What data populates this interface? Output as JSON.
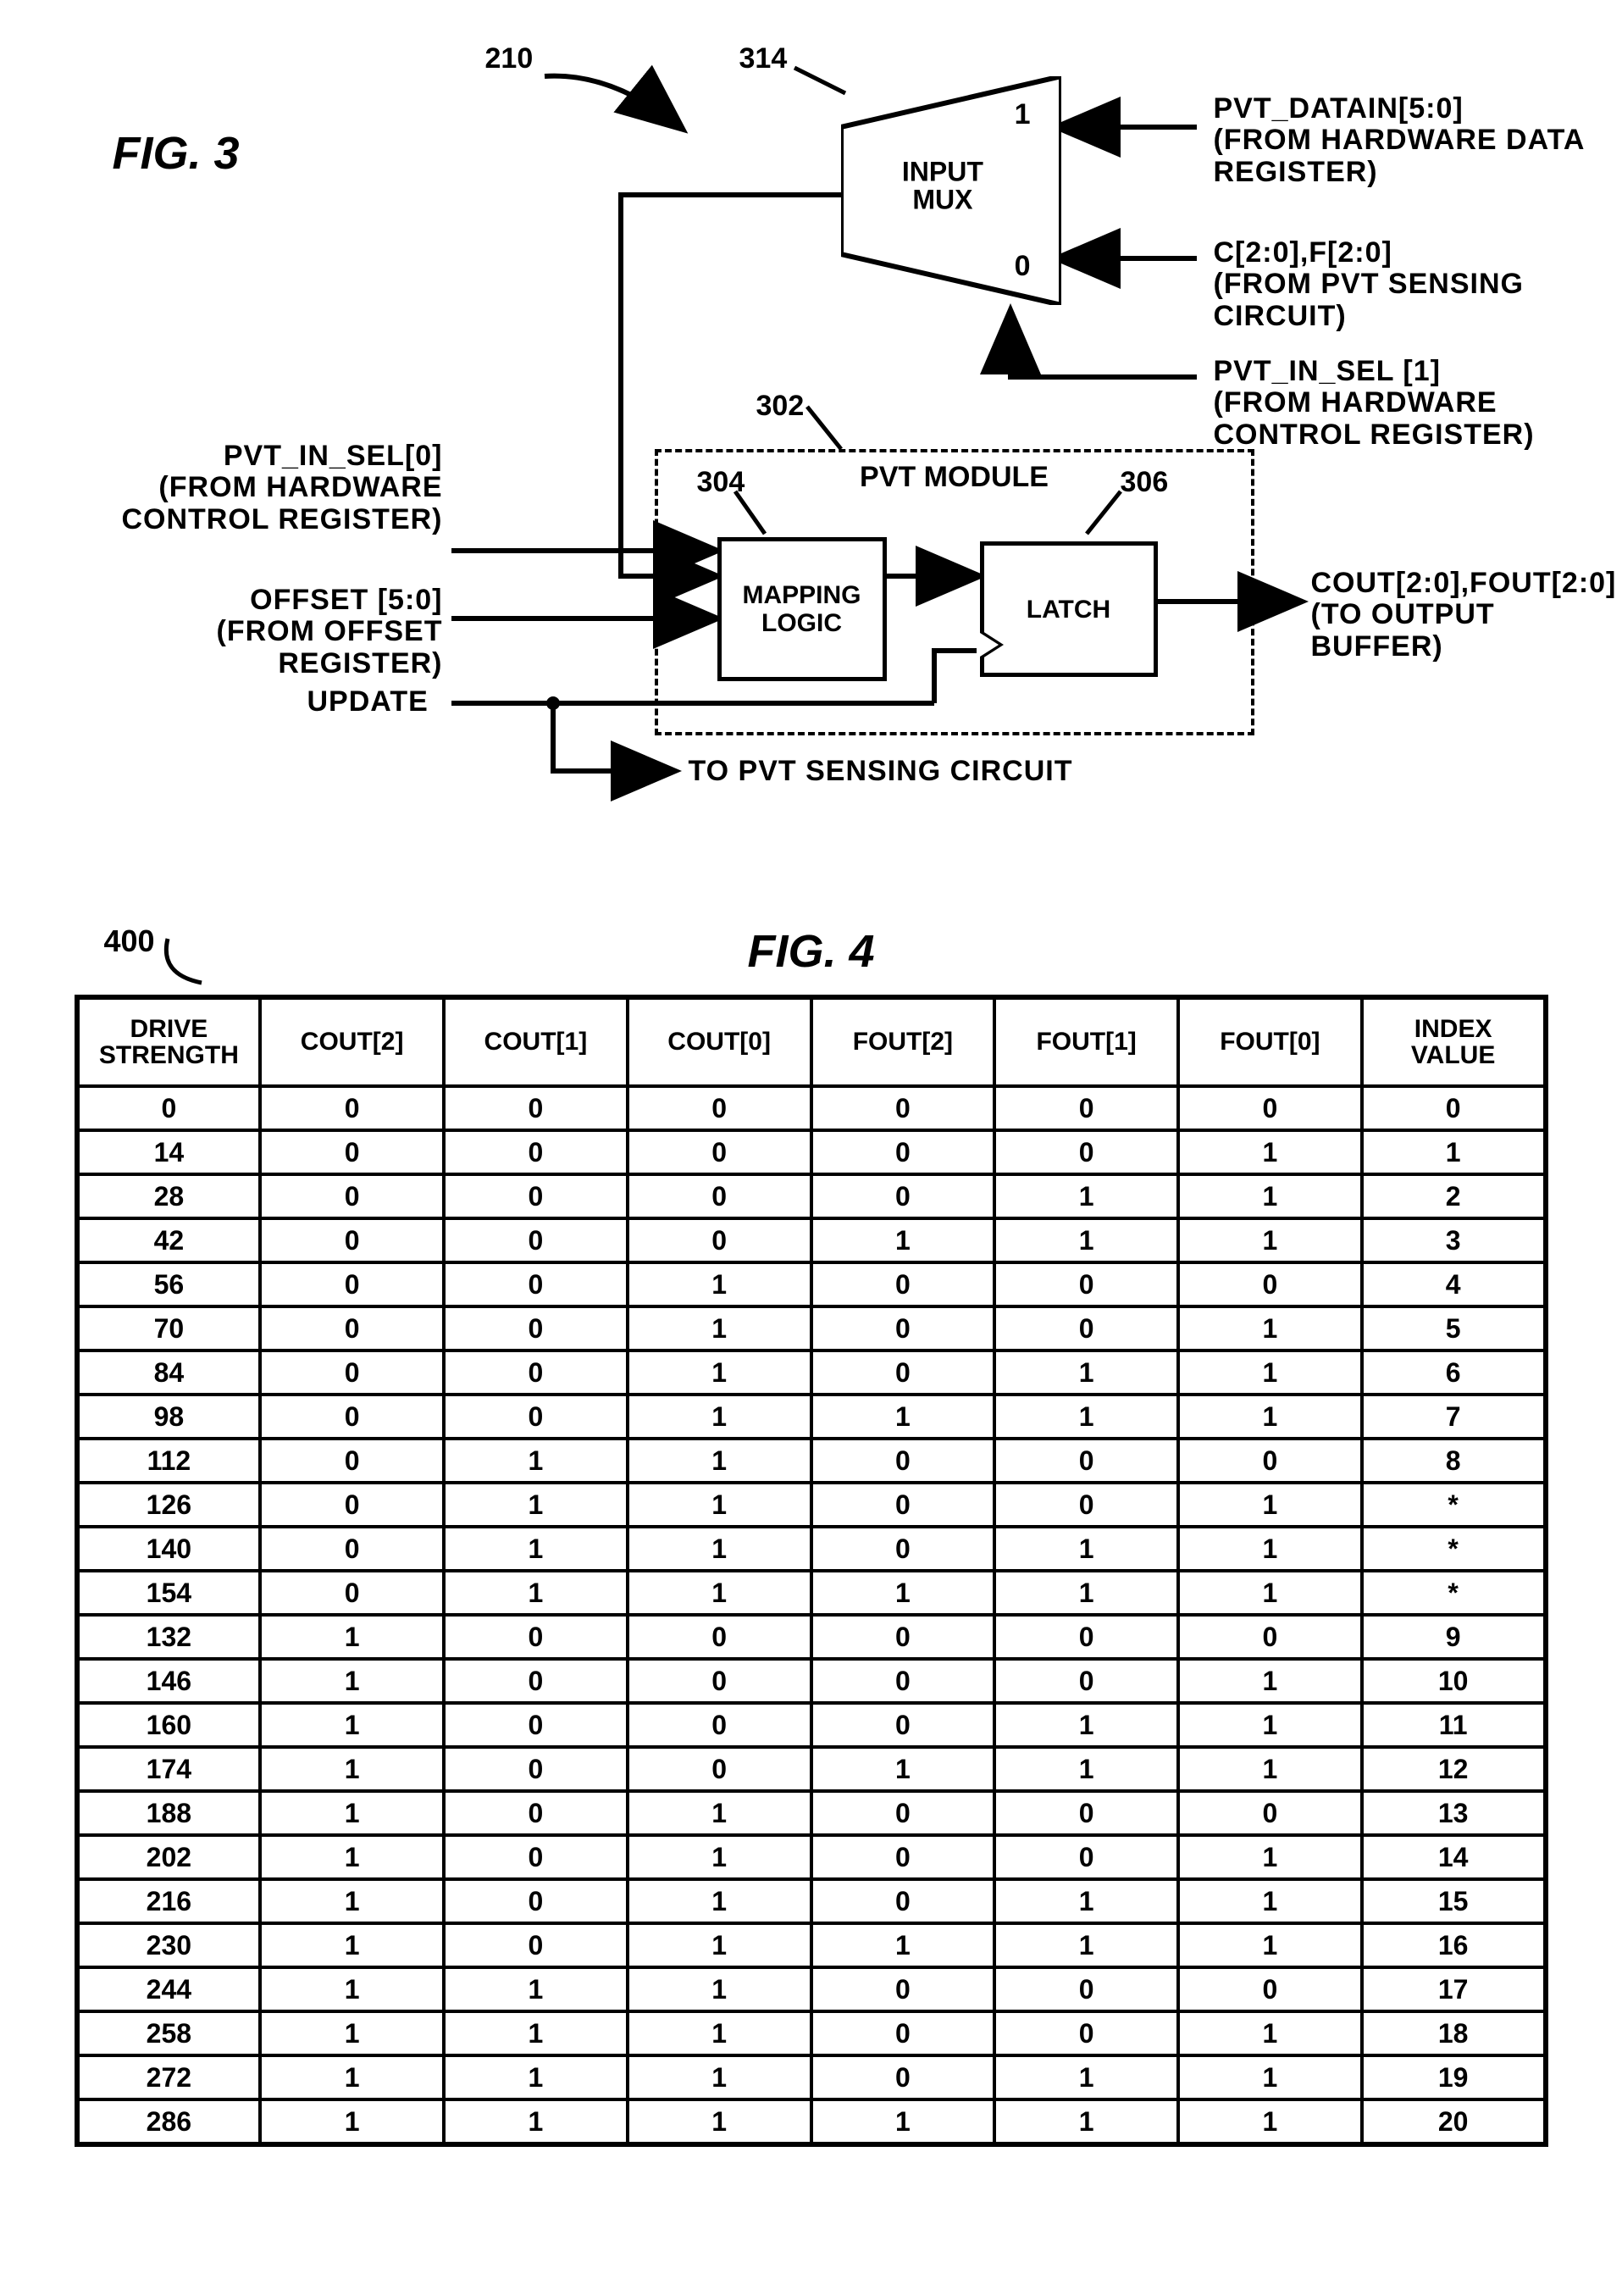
{
  "fig3": {
    "title": "FIG. 3",
    "callouts": {
      "c210": "210",
      "c314": "314",
      "c302": "302",
      "c304": "304",
      "c306": "306"
    },
    "mux": {
      "label_line1": "INPUT",
      "label_line2": "MUX",
      "port_top": "1",
      "port_bot": "0"
    },
    "pvt_module": {
      "title": "PVT MODULE",
      "mapping": "MAPPING LOGIC",
      "latch": "LATCH"
    },
    "signals": {
      "pvt_datain": "PVT_DATAIN[5:0]",
      "pvt_datain_sub": "(FROM HARDWARE DATA REGISTER)",
      "cf": "C[2:0],F[2:0]",
      "cf_sub": "(FROM PVT SENSING CIRCUIT)",
      "pvt_in_sel1": "PVT_IN_SEL [1]",
      "pvt_in_sel1_sub": "(FROM HARDWARE CONTROL REGISTER)",
      "pvt_in_sel0": "PVT_IN_SEL[0]",
      "pvt_in_sel0_sub": "(FROM HARDWARE CONTROL REGISTER)",
      "offset": "OFFSET [5:0]",
      "offset_sub": "(FROM OFFSET REGISTER)",
      "update": "UPDATE",
      "cout": "COUT[2:0],FOUT[2:0]",
      "cout_sub": "(TO OUTPUT BUFFER)",
      "to_sense": "TO PVT SENSING CIRCUIT"
    }
  },
  "fig4": {
    "title": "FIG. 4",
    "callout": "400",
    "headers": [
      "DRIVE STRENGTH",
      "COUT[2]",
      "COUT[1]",
      "COUT[0]",
      "FOUT[2]",
      "FOUT[1]",
      "FOUT[0]",
      "INDEX VALUE"
    ]
  },
  "chart_data": {
    "type": "table",
    "columns": [
      "DRIVE STRENGTH",
      "COUT[2]",
      "COUT[1]",
      "COUT[0]",
      "FOUT[2]",
      "FOUT[1]",
      "FOUT[0]",
      "INDEX VALUE"
    ],
    "rows": [
      [
        "0",
        "0",
        "0",
        "0",
        "0",
        "0",
        "0",
        "0"
      ],
      [
        "14",
        "0",
        "0",
        "0",
        "0",
        "0",
        "1",
        "1"
      ],
      [
        "28",
        "0",
        "0",
        "0",
        "0",
        "1",
        "1",
        "2"
      ],
      [
        "42",
        "0",
        "0",
        "0",
        "1",
        "1",
        "1",
        "3"
      ],
      [
        "56",
        "0",
        "0",
        "1",
        "0",
        "0",
        "0",
        "4"
      ],
      [
        "70",
        "0",
        "0",
        "1",
        "0",
        "0",
        "1",
        "5"
      ],
      [
        "84",
        "0",
        "0",
        "1",
        "0",
        "1",
        "1",
        "6"
      ],
      [
        "98",
        "0",
        "0",
        "1",
        "1",
        "1",
        "1",
        "7"
      ],
      [
        "112",
        "0",
        "1",
        "1",
        "0",
        "0",
        "0",
        "8"
      ],
      [
        "126",
        "0",
        "1",
        "1",
        "0",
        "0",
        "1",
        "*"
      ],
      [
        "140",
        "0",
        "1",
        "1",
        "0",
        "1",
        "1",
        "*"
      ],
      [
        "154",
        "0",
        "1",
        "1",
        "1",
        "1",
        "1",
        "*"
      ],
      [
        "132",
        "1",
        "0",
        "0",
        "0",
        "0",
        "0",
        "9"
      ],
      [
        "146",
        "1",
        "0",
        "0",
        "0",
        "0",
        "1",
        "10"
      ],
      [
        "160",
        "1",
        "0",
        "0",
        "0",
        "1",
        "1",
        "11"
      ],
      [
        "174",
        "1",
        "0",
        "0",
        "1",
        "1",
        "1",
        "12"
      ],
      [
        "188",
        "1",
        "0",
        "1",
        "0",
        "0",
        "0",
        "13"
      ],
      [
        "202",
        "1",
        "0",
        "1",
        "0",
        "0",
        "1",
        "14"
      ],
      [
        "216",
        "1",
        "0",
        "1",
        "0",
        "1",
        "1",
        "15"
      ],
      [
        "230",
        "1",
        "0",
        "1",
        "1",
        "1",
        "1",
        "16"
      ],
      [
        "244",
        "1",
        "1",
        "1",
        "0",
        "0",
        "0",
        "17"
      ],
      [
        "258",
        "1",
        "1",
        "1",
        "0",
        "0",
        "1",
        "18"
      ],
      [
        "272",
        "1",
        "1",
        "1",
        "0",
        "1",
        "1",
        "19"
      ],
      [
        "286",
        "1",
        "1",
        "1",
        "1",
        "1",
        "1",
        "20"
      ]
    ]
  }
}
